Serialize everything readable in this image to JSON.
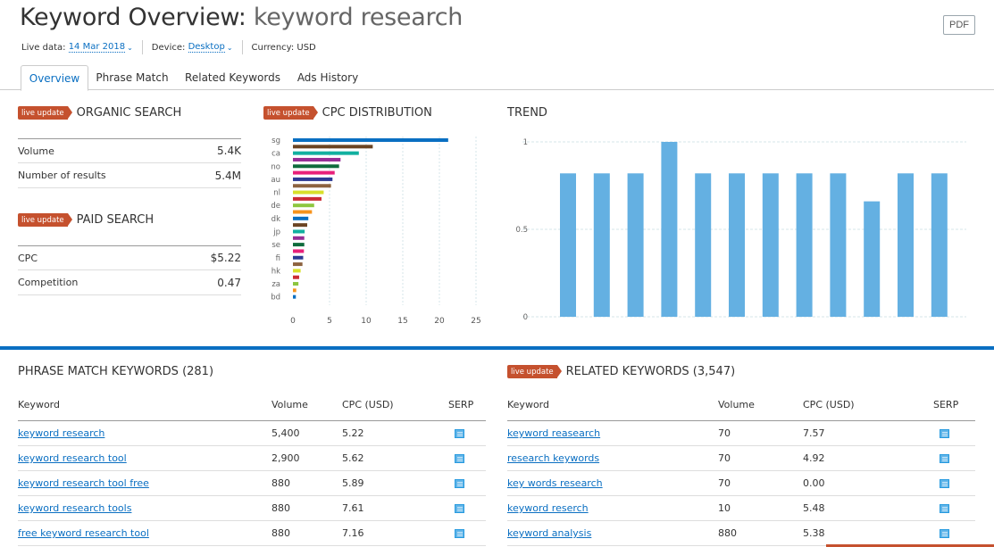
{
  "header": {
    "title_prefix": "Keyword Overview: ",
    "title_keyword": "keyword research",
    "live_data_label": "Live data:",
    "live_data_value": "14 Mar 2018",
    "device_label": "Device:",
    "device_value": "Desktop",
    "currency_label": "Currency: USD",
    "pdf_label": "PDF"
  },
  "tabs": [
    {
      "label": "Overview",
      "active": true
    },
    {
      "label": "Phrase Match",
      "active": false
    },
    {
      "label": "Related Keywords",
      "active": false
    },
    {
      "label": "Ads History",
      "active": false
    }
  ],
  "badge_label": "live update",
  "organic": {
    "title": "ORGANIC SEARCH",
    "rows": [
      {
        "label": "Volume",
        "value": "5.4K"
      },
      {
        "label": "Number of results",
        "value": "5.4M"
      }
    ]
  },
  "paid": {
    "title": "PAID SEARCH",
    "rows": [
      {
        "label": "CPC",
        "value": "$5.22"
      },
      {
        "label": "Competition",
        "value": "0.47"
      }
    ]
  },
  "chart_data": [
    {
      "type": "bar",
      "orientation": "horizontal",
      "title": "CPC DISTRIBUTION",
      "categories": [
        "sg",
        "",
        "ca",
        "",
        "no",
        "",
        "au",
        "",
        "nl",
        "",
        "de",
        "",
        "dk",
        "",
        "jp",
        "",
        "se",
        "",
        "fi",
        "",
        "hk",
        "",
        "za",
        "",
        "bd"
      ],
      "values": [
        21.2,
        10.9,
        9.0,
        6.5,
        6.3,
        5.7,
        5.4,
        5.2,
        4.2,
        3.9,
        2.9,
        2.6,
        2.1,
        1.95,
        1.6,
        1.55,
        1.55,
        1.5,
        1.4,
        1.3,
        1.05,
        0.85,
        0.75,
        0.45,
        0.4
      ],
      "colors": [
        "#0a6fc2",
        "#6b4423",
        "#12b0a0",
        "#962d96",
        "#0f6b3c",
        "#e8207a",
        "#2d3a94",
        "#8d6340",
        "#d8e02a",
        "#cc2c34",
        "#8dc63f",
        "#f7941d"
      ],
      "xlim": [
        0,
        25
      ],
      "xticks": [
        0,
        5,
        10,
        15,
        20,
        25
      ],
      "grid": true
    },
    {
      "type": "bar",
      "title": "TREND",
      "values": [
        0.82,
        0.82,
        0.82,
        1.0,
        0.82,
        0.82,
        0.82,
        0.82,
        0.82,
        0.66,
        0.82,
        0.82
      ],
      "ylim": [
        0,
        1
      ],
      "yticks": [
        0,
        0.5,
        1
      ],
      "ytick_labels": [
        "0",
        "0.5",
        "1"
      ],
      "color": "#64b0e2",
      "grid": true
    }
  ],
  "phrase_match": {
    "title": "PHRASE MATCH KEYWORDS (281)",
    "columns": [
      "Keyword",
      "Volume",
      "CPC (USD)",
      "SERP"
    ],
    "rows": [
      {
        "keyword": "keyword research",
        "volume": "5,400",
        "cpc": "5.22"
      },
      {
        "keyword": "keyword research tool",
        "volume": "2,900",
        "cpc": "5.62"
      },
      {
        "keyword": "keyword research tool free",
        "volume": "880",
        "cpc": "5.89"
      },
      {
        "keyword": "keyword research tools",
        "volume": "880",
        "cpc": "7.61"
      },
      {
        "keyword": "free keyword research tool",
        "volume": "880",
        "cpc": "7.16"
      }
    ]
  },
  "related": {
    "title": "RELATED KEYWORDS (3,547)",
    "columns": [
      "Keyword",
      "Volume",
      "CPC (USD)",
      "SERP"
    ],
    "rows": [
      {
        "keyword": "keyword reasearch",
        "volume": "70",
        "cpc": "7.57"
      },
      {
        "keyword": "research keywords",
        "volume": "70",
        "cpc": "4.92"
      },
      {
        "keyword": "key words research",
        "volume": "70",
        "cpc": "0.00"
      },
      {
        "keyword": "keyword reserch",
        "volume": "10",
        "cpc": "5.48"
      },
      {
        "keyword": "keyword analysis",
        "volume": "880",
        "cpc": "5.38"
      }
    ]
  }
}
